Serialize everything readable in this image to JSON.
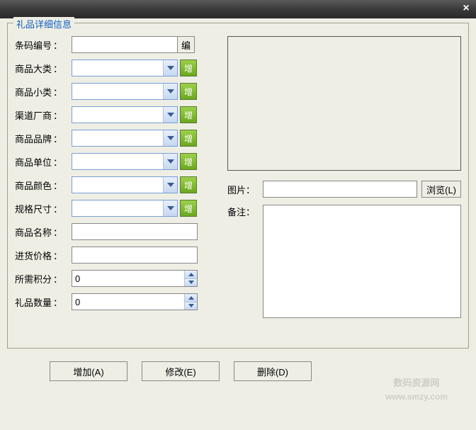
{
  "titlebar": {
    "close_icon": "×"
  },
  "group_title": "礼品详细信息",
  "fields": {
    "barcode": {
      "label": "条码编号",
      "value": "",
      "btn": "编"
    },
    "major_cat": {
      "label": "商品大类",
      "value": "",
      "btn": "增"
    },
    "minor_cat": {
      "label": "商品小类",
      "value": "",
      "btn": "增"
    },
    "vendor": {
      "label": "渠道厂商",
      "value": "",
      "btn": "增"
    },
    "brand": {
      "label": "商品品牌",
      "value": "",
      "btn": "增"
    },
    "unit": {
      "label": "商品单位",
      "value": "",
      "btn": "增"
    },
    "color": {
      "label": "商品颜色",
      "value": "",
      "btn": "增"
    },
    "spec": {
      "label": "规格尺寸",
      "value": "",
      "btn": "增"
    },
    "name": {
      "label": "商品名称",
      "value": ""
    },
    "cost": {
      "label": "进货价格",
      "value": ""
    },
    "points": {
      "label": "所需积分",
      "value": "0"
    },
    "qty": {
      "label": "礼品数量",
      "value": "0"
    }
  },
  "right": {
    "image_label": "图片",
    "image_path": "",
    "browse_btn": "浏览(L)",
    "notes_label": "备注",
    "notes_value": ""
  },
  "buttons": {
    "add": "增加(A)",
    "edit": "修改(E)",
    "delete": "删除(D)"
  },
  "colon": "：",
  "watermark": {
    "line1": "数码资源网",
    "line2": "www.smzy.com"
  }
}
